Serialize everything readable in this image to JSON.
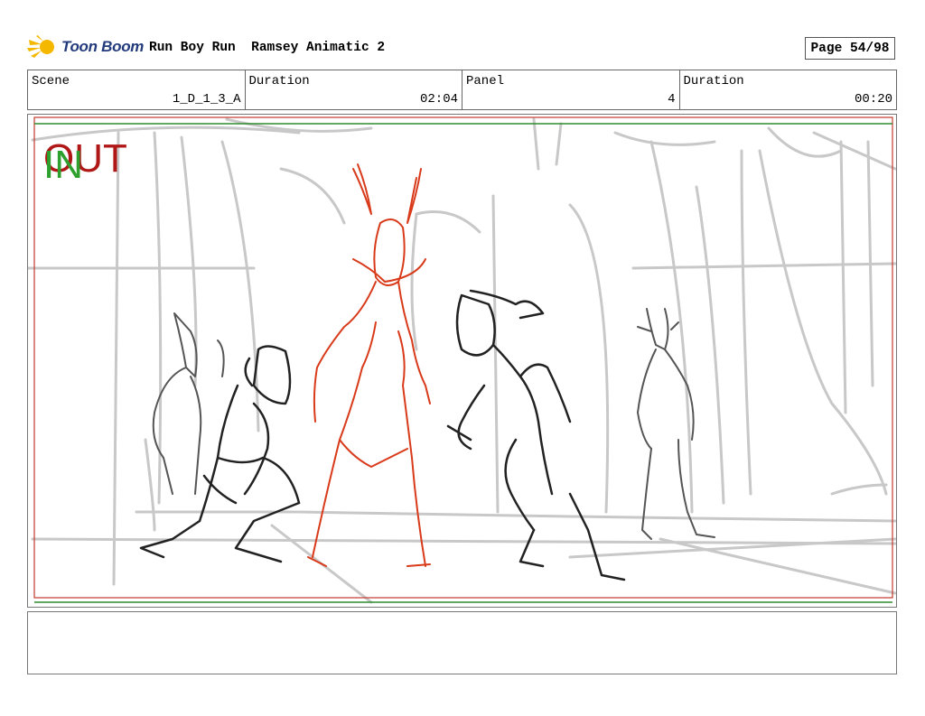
{
  "header": {
    "logo_text": "Toon Boom",
    "project_title": "Run Boy Run  Ramsey Animatic 2",
    "page_label": "Page 54/98"
  },
  "info": {
    "scene_label": "Scene",
    "scene_value": "1_D_1_3_A",
    "scene_duration_label": "Duration",
    "scene_duration_value": "02:04",
    "panel_label": "Panel",
    "panel_value": "4",
    "panel_duration_label": "Duration",
    "panel_duration_value": "00:20"
  },
  "panel": {
    "out_marker": "OUT",
    "in_marker": "IN",
    "out_color": "#b01818",
    "in_color": "#2ea02e"
  },
  "notes": {
    "text": ""
  }
}
